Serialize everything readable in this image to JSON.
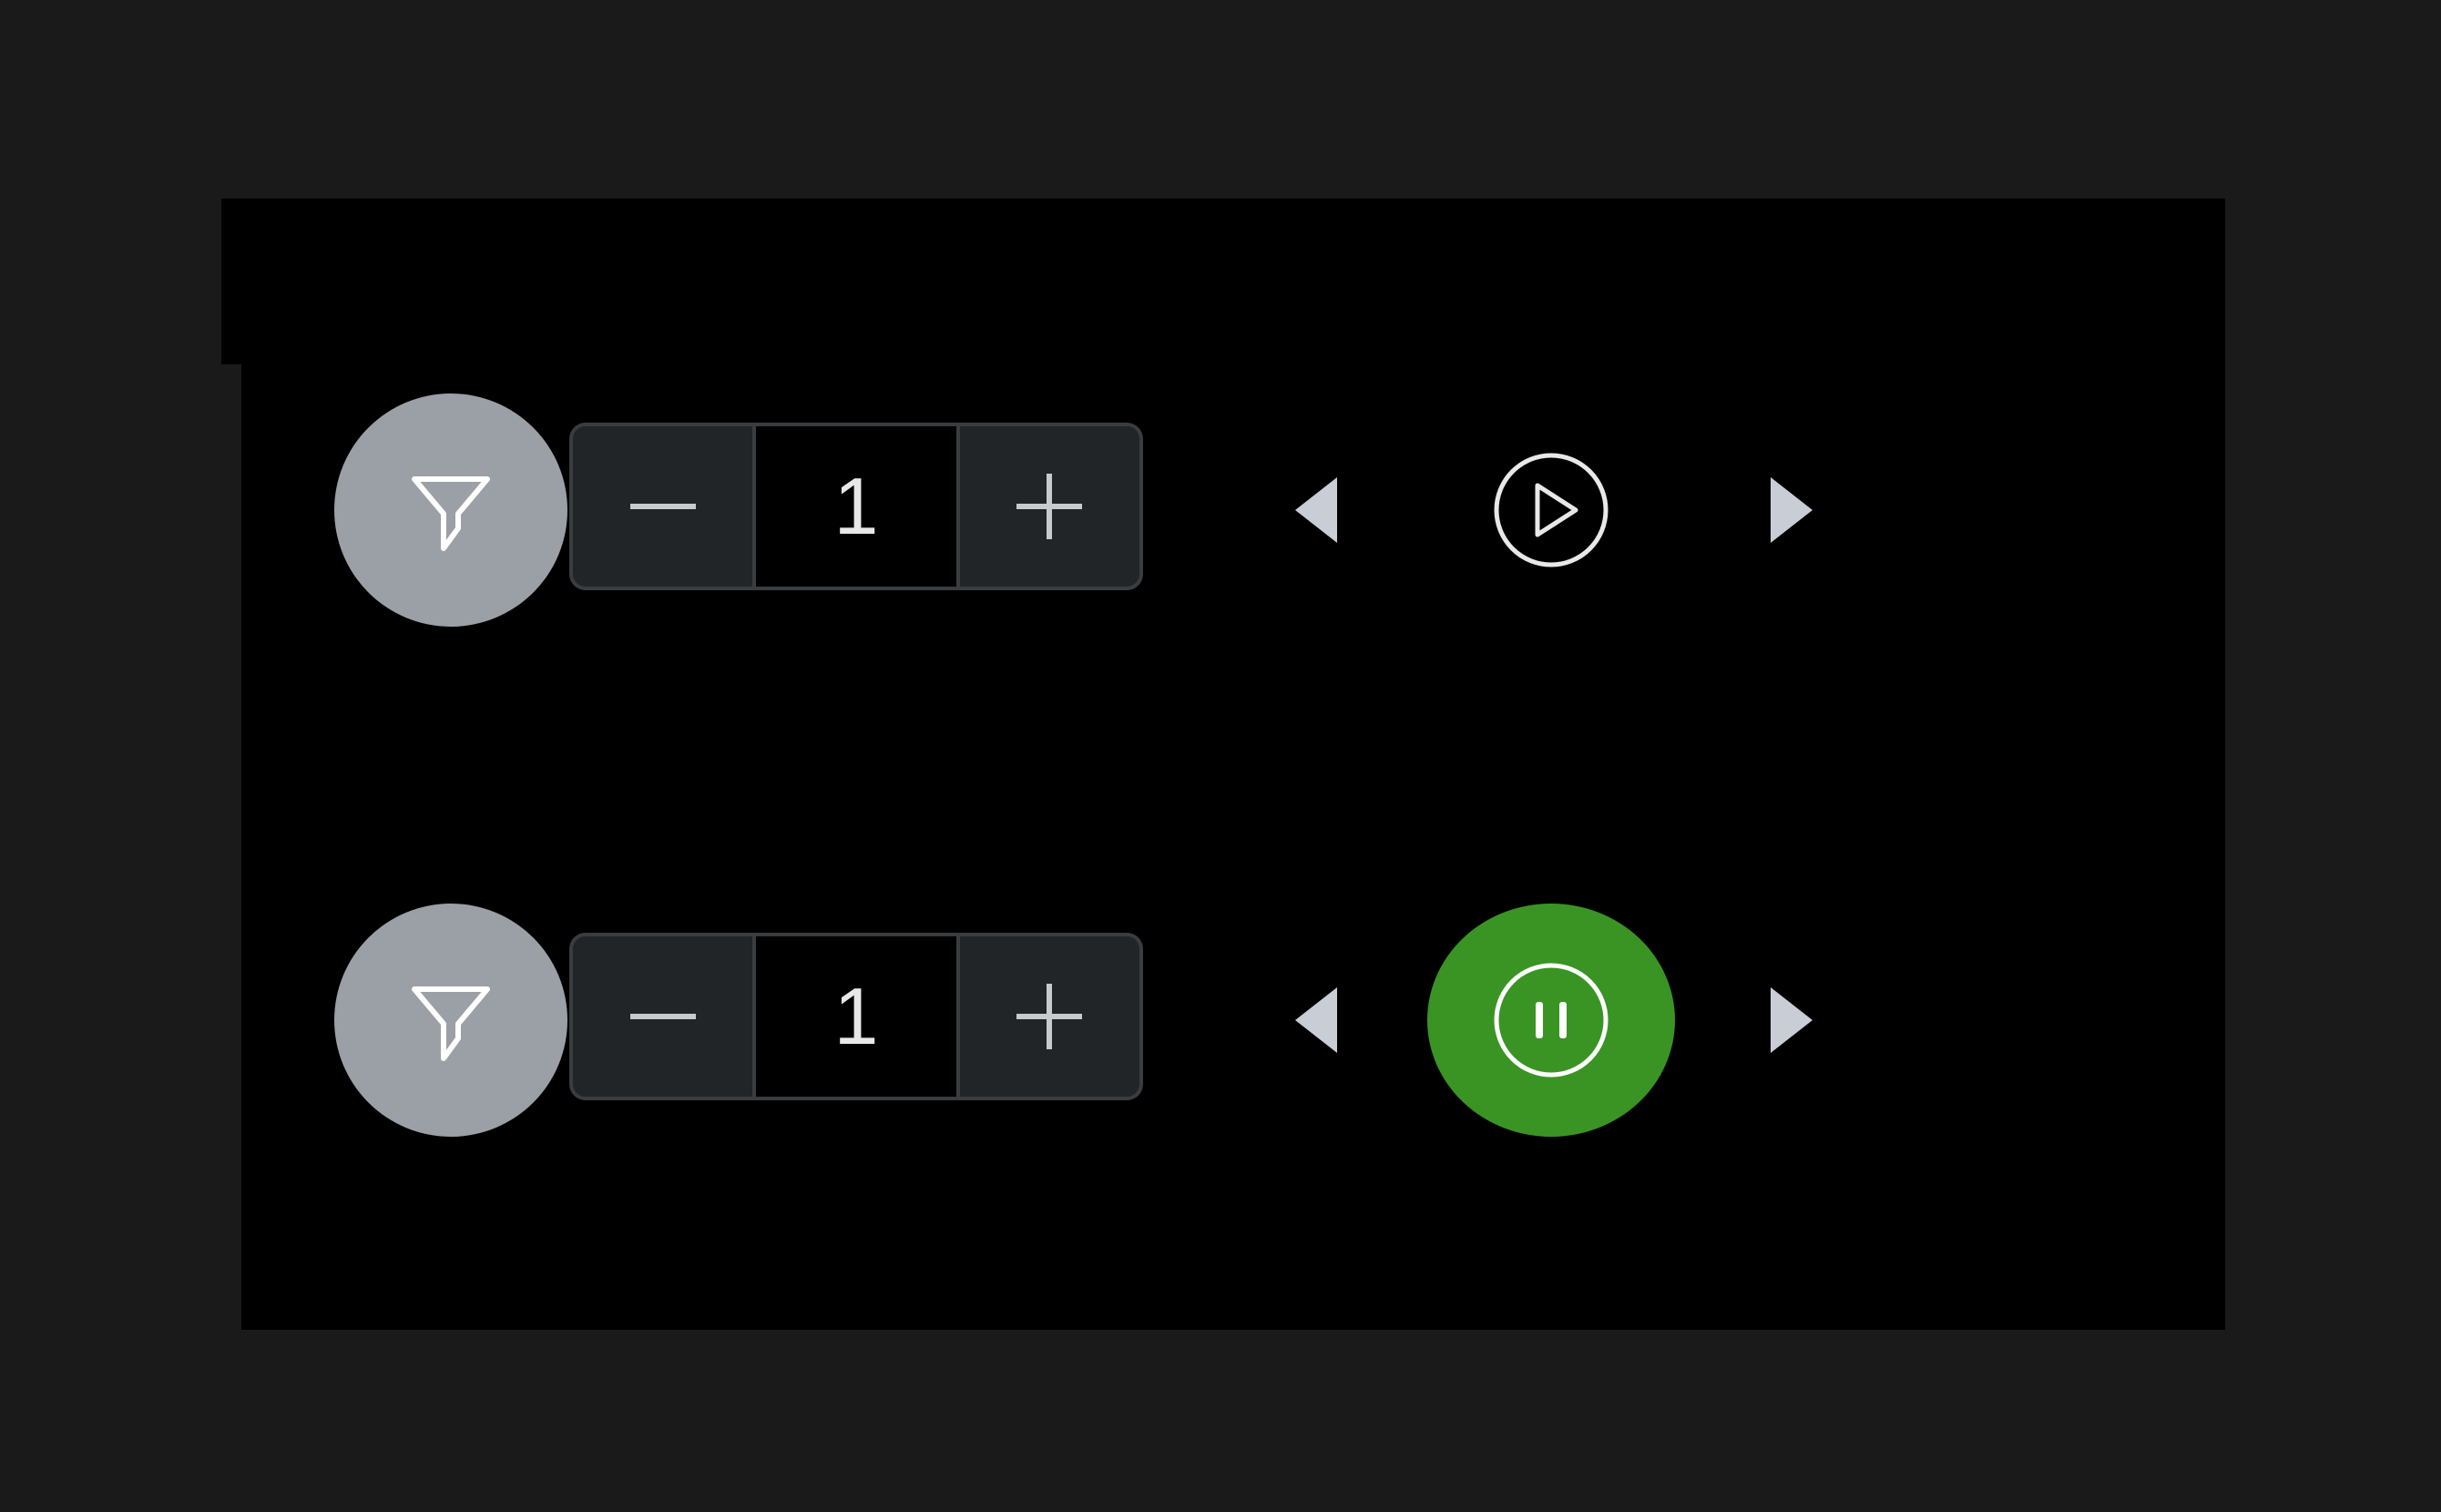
{
  "colors": {
    "page_background": "#1a1a1a",
    "panel_background": "#000000",
    "filter_button": "#9ba0a6",
    "stepper_background": "#222527",
    "stepper_border": "#3a3d40",
    "active_play": "#3a9424",
    "icon": "#e8e8e8"
  },
  "rows": [
    {
      "filter_icon": "filter-icon",
      "stepper": {
        "value": "1",
        "minus_icon": "minus-icon",
        "plus_icon": "plus-icon"
      },
      "prev_icon": "caret-left-icon",
      "play_state": "paused",
      "play_icon": "play-circle-icon",
      "next_icon": "caret-right-icon"
    },
    {
      "filter_icon": "filter-icon",
      "stepper": {
        "value": "1",
        "minus_icon": "minus-icon",
        "plus_icon": "plus-icon"
      },
      "prev_icon": "caret-left-icon",
      "play_state": "playing",
      "play_icon": "pause-circle-icon",
      "next_icon": "caret-right-icon"
    }
  ]
}
